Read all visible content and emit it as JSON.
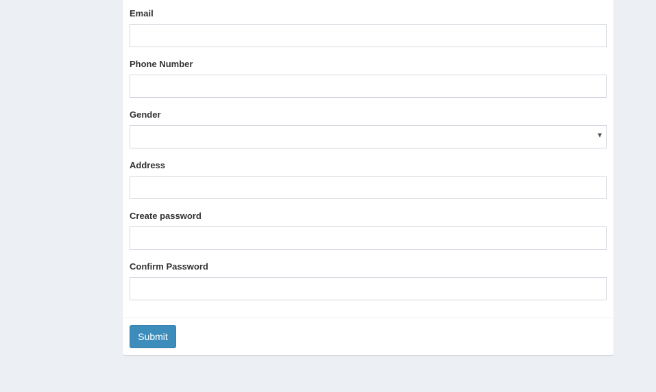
{
  "form": {
    "fields": [
      {
        "label": "Email",
        "value": "",
        "type": "text"
      },
      {
        "label": "Phone Number",
        "value": "",
        "type": "text"
      },
      {
        "label": "Gender",
        "value": "",
        "type": "select"
      },
      {
        "label": "Address",
        "value": "",
        "type": "text"
      },
      {
        "label": "Create password",
        "value": "",
        "type": "password"
      },
      {
        "label": "Confirm Password",
        "value": "",
        "type": "password"
      }
    ],
    "gender_icon": "caret-down-icon"
  },
  "footer": {
    "submit_label": "Submit"
  },
  "colors": {
    "page_background": "#ecf0f5",
    "card_background": "#ffffff",
    "input_border": "#d2d6de",
    "button_primary": "#3c8dbc",
    "label_text": "#333333"
  }
}
